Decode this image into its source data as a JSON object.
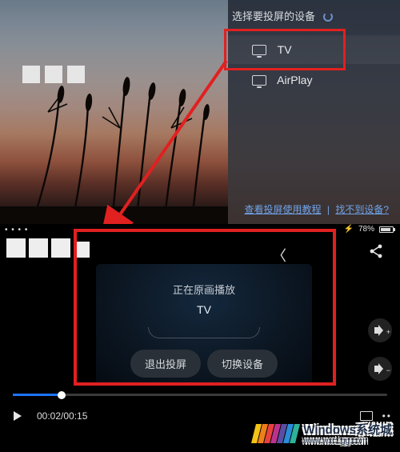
{
  "colors": {
    "red": "#e12020",
    "blue": "#1d74ff"
  },
  "top": {
    "chooser_title": "选择要投屏的设备",
    "devices": {
      "tv": "TV",
      "airplay": "AirPlay"
    },
    "link_tutorial": "查看投屏使用教程",
    "link_nofind": "找不到设备?",
    "link_sep": "|"
  },
  "bottom": {
    "statusbar": {
      "signal_dots": "• • • •",
      "battery_pct": "78%",
      "clock": ""
    },
    "cast_status": "正在原画播放",
    "cast_device": "TV",
    "btn_exit": "退出投屏",
    "btn_switch": "切换设备"
  },
  "player": {
    "current": "00:02",
    "duration": "00:15",
    "time_sep": "/",
    "progress_pct": 13
  },
  "watermark": {
    "brand": "Windows系统城",
    "url": "www.wxcLgg.com",
    "flag_colors": [
      "#f4c316",
      "#ee7f1b",
      "#e8423c",
      "#b9338d",
      "#5a4ea2",
      "#2a8bd6",
      "#2db29a"
    ]
  }
}
